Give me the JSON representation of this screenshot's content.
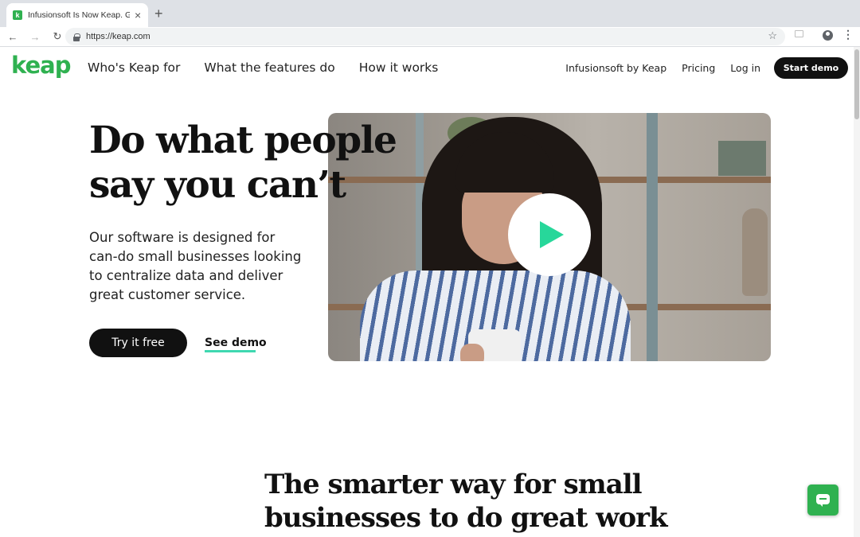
{
  "browser": {
    "tab_title": "Infusionsoft Is Now Keap. Get",
    "tab_close": "×",
    "new_tab": "+",
    "url": "https://keap.com",
    "favicon_letter": "k"
  },
  "nav": {
    "logo": "keap",
    "main_links": [
      "Who's Keap for",
      "What the features do",
      "How it works"
    ],
    "right_links": [
      "Infusionsoft by Keap",
      "Pricing",
      "Log in"
    ],
    "cta": "Start demo"
  },
  "hero": {
    "title_line1": "Do what people",
    "title_line2": "say you can’t",
    "subtitle_line1": "Our software is designed for",
    "subtitle_line2": "can-do small businesses looking",
    "subtitle_line3": "to centralize data and deliver",
    "subtitle_line4": "great customer service.",
    "primary_button": "Try it free",
    "secondary_link": "See demo"
  },
  "section": {
    "title_line1": "The smarter way for small",
    "title_line2": "businesses to do great work"
  },
  "colors": {
    "brand_green": "#2fb150",
    "play_green": "#27d79a",
    "underline_teal": "#3fd8b0"
  }
}
